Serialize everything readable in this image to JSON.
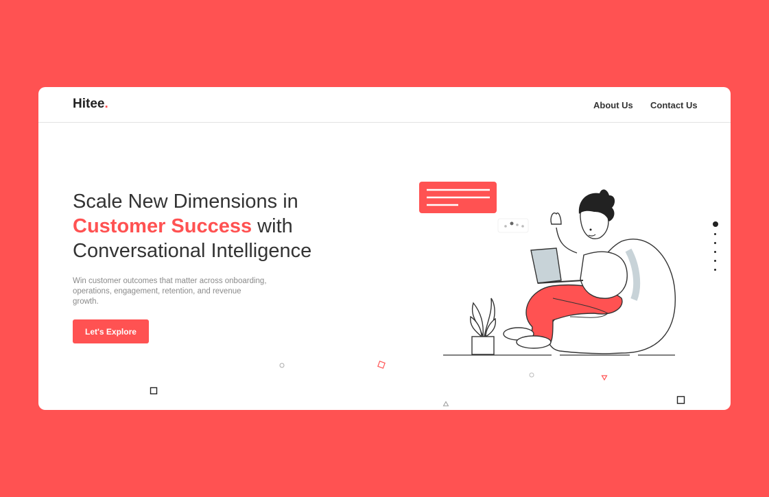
{
  "header": {
    "logo_text": "Hitee",
    "logo_dot": ".",
    "nav": [
      "About Us",
      "Contact Us"
    ]
  },
  "hero": {
    "headline_start": "Scale New Dimensions in",
    "headline_accent": "Customer Success",
    "headline_mid": " with",
    "headline_end": "Conversational Intelligence",
    "description": "Win customer outcomes that matter across onboarding, operations, engagement, retention, and revenue growth.",
    "cta_label": "Let's Explore"
  },
  "slider": {
    "slides": 6,
    "active": 1
  },
  "colors": {
    "brand": "#ff5252",
    "text": "#333333",
    "muted": "#8a8a8a"
  },
  "icons": [
    "chat-bubble-icon",
    "typing-indicator-icon",
    "plant-icon"
  ]
}
